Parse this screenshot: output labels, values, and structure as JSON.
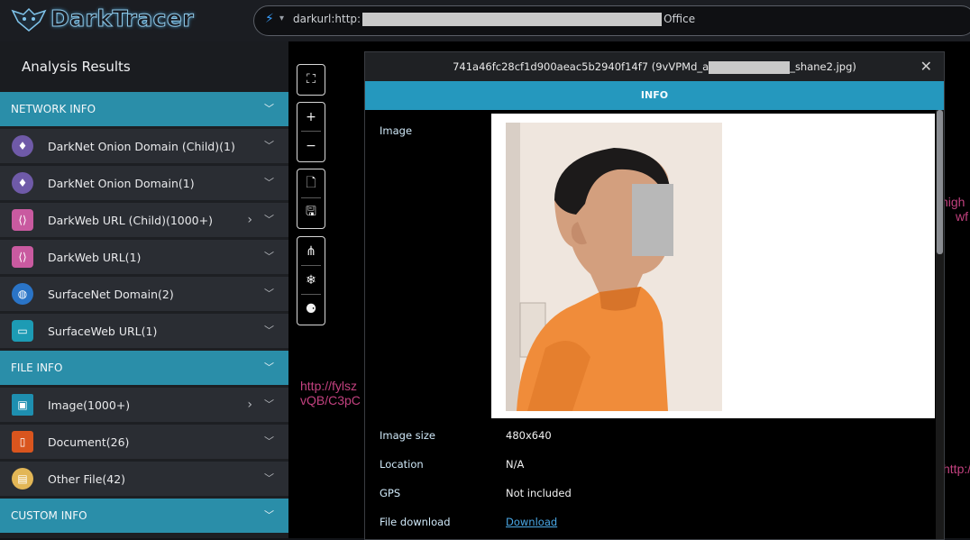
{
  "app": {
    "name": "DarkTracer",
    "search_query_prefix": "darkurl:http:",
    "search_query_suffix": "Office"
  },
  "sidebar": {
    "title": "Analysis Results",
    "sections": [
      {
        "label": "NETWORK INFO",
        "items": [
          {
            "label": "DarkNet Onion Domain (Child)(1)",
            "icon": "onion-icon"
          },
          {
            "label": "DarkNet Onion Domain(1)",
            "icon": "onion-icon"
          },
          {
            "label": "DarkWeb URL (Child)(1000+)",
            "icon": "web-code-icon"
          },
          {
            "label": "DarkWeb URL(1)",
            "icon": "web-code-icon"
          },
          {
            "label": "SurfaceNet Domain(2)",
            "icon": "globe-icon"
          },
          {
            "label": "SurfaceWeb URL(1)",
            "icon": "browser-window-icon"
          }
        ]
      },
      {
        "label": "FILE INFO",
        "items": [
          {
            "label": "Image(1000+)",
            "icon": "image-icon"
          },
          {
            "label": "Document(26)",
            "icon": "document-icon"
          },
          {
            "label": "Other File(42)",
            "icon": "file-icon"
          }
        ]
      },
      {
        "label": "CUSTOM INFO",
        "items": []
      }
    ]
  },
  "background_text": {
    "url1_line1": "http://fylsz",
    "url1_line2": "vQB/C3pC",
    "right1_line1": "high",
    "right1_line2": "wf",
    "right2": "http://"
  },
  "modal": {
    "title_prefix": "741a46fc28cf1d900aeac5b2940f14f7 (9vVPMd_a",
    "title_suffix": "_shane2.jpg)",
    "tab": "INFO",
    "fields": {
      "image_label": "Image",
      "size_label": "Image size",
      "size_value": "480x640",
      "location_label": "Location",
      "location_value": "N/A",
      "gps_label": "GPS",
      "gps_value": "Not included",
      "download_label": "File download",
      "download_value": "Download"
    }
  },
  "colors": {
    "accent": "#2a8ea9",
    "tab": "#2598be",
    "link": "#4aa8e6",
    "bg_text": "#c2417f"
  }
}
